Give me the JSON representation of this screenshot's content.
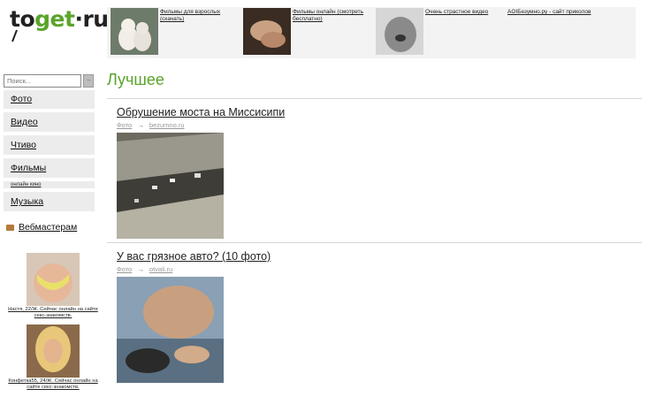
{
  "logo": {
    "text_part1": "to",
    "text_part2": "get",
    "text_part3": "·ru"
  },
  "top_ads": [
    {
      "label": "Фильмы для взрослых (скачать)"
    },
    {
      "label": "Фильмы онлайн (смотреть бесплатно)"
    },
    {
      "label": "Очень страстное видео"
    },
    {
      "label": "AOIБезумно.ру - сайт приколов"
    }
  ],
  "search": {
    "placeholder": "Поиск...",
    "button": "→"
  },
  "sidebar": {
    "items": [
      {
        "label": "Фото"
      },
      {
        "label": "Видео"
      },
      {
        "label": "Чтиво"
      },
      {
        "label": "Фильмы"
      },
      {
        "label": "онлайн кино"
      },
      {
        "label": "Музыка"
      }
    ],
    "webmaster": "Вебмастерам"
  },
  "side_ads": [
    {
      "caption": "Настя, 22/Ж. Сейчас онлайн на сайте секс-знакомств."
    },
    {
      "caption": "Конфетка55, 24/Ж. Сейчас онлайн на сайте секс-знакомств."
    }
  ],
  "main": {
    "section_title": "Лучшее",
    "articles": [
      {
        "title": "Обрушение моста на Миссисипи",
        "category": "Фото",
        "arrow": "→",
        "source": "bezumno.ru"
      },
      {
        "title": "У вас грязное авто? (10 фото)",
        "category": "Фото",
        "arrow": "→",
        "source": "otvali.ru"
      }
    ]
  }
}
